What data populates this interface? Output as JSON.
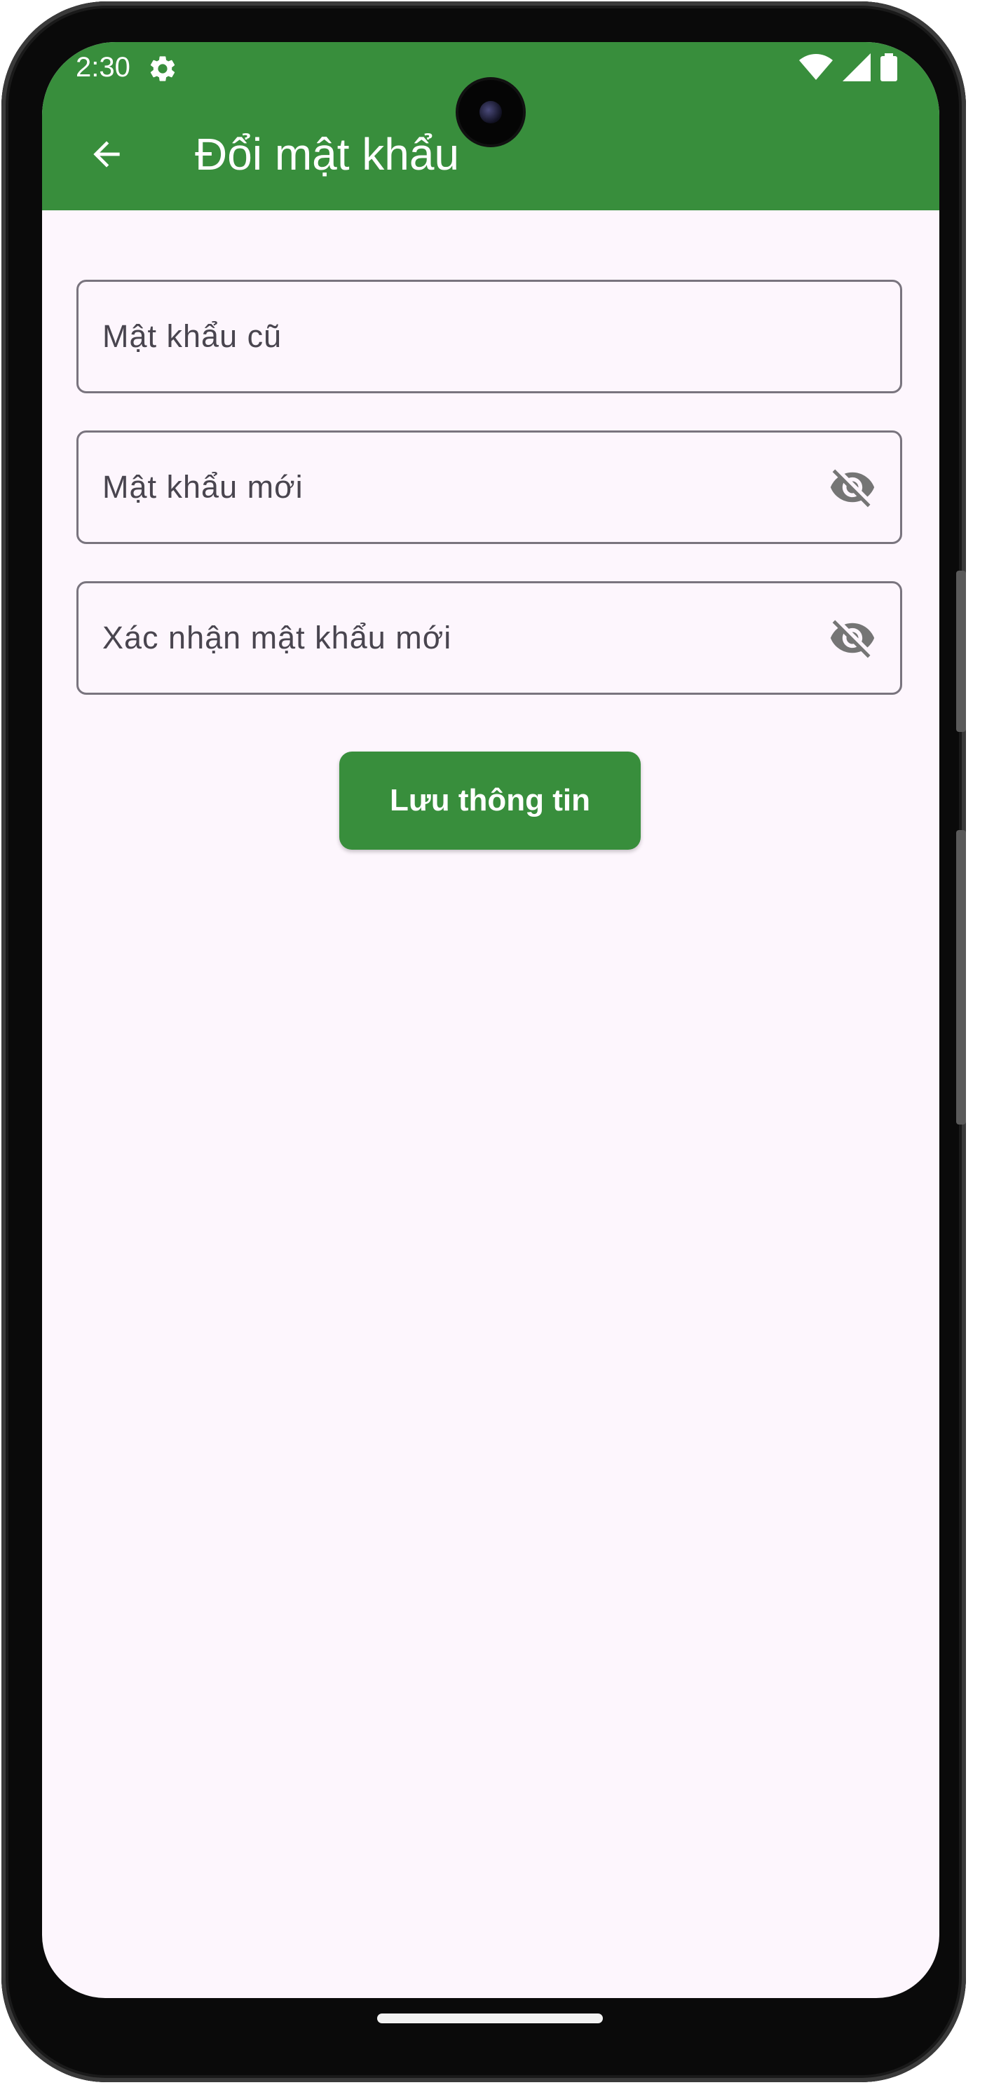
{
  "status_bar": {
    "time": "2:30",
    "settings_icon": "gear-icon",
    "right_icons": [
      "wifi-icon",
      "signal-icon",
      "battery-icon"
    ]
  },
  "app_bar": {
    "title": "Đổi mật khẩu",
    "back_icon": "arrow-back-icon"
  },
  "form": {
    "old_password": {
      "placeholder": "Mật khẩu cũ",
      "value": ""
    },
    "new_password": {
      "placeholder": "Mật khẩu mới",
      "value": "",
      "toggle_icon": "visibility-off-icon"
    },
    "confirm_password": {
      "placeholder": "Xác nhận mật khẩu mới",
      "value": "",
      "toggle_icon": "visibility-off-icon"
    }
  },
  "save_button": {
    "label": "Lưu thông tin"
  },
  "colors": {
    "primary": "#388e3c",
    "background": "#fdf6fd",
    "outline": "#79747e",
    "icon_gray": "#757575"
  }
}
